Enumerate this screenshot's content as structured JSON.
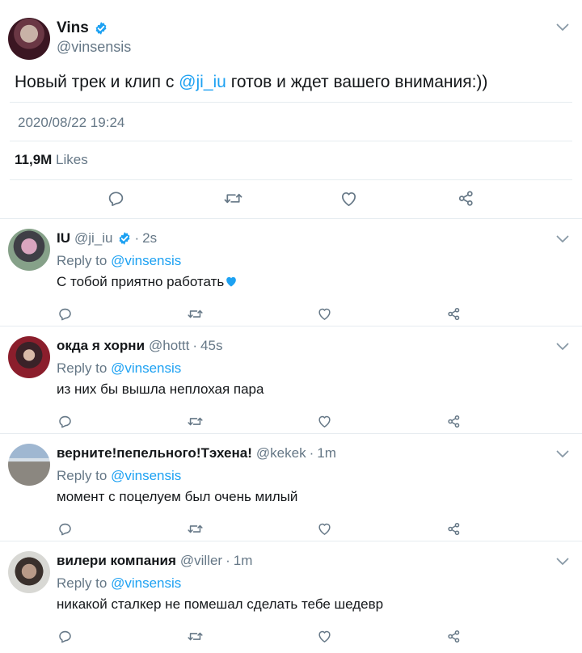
{
  "main_tweet": {
    "name": "Vins",
    "handle": "@vinsensis",
    "text_before": "Новый трек и клип с ",
    "mention": "@ji_iu",
    "text_after": " готов и ждет вашего внимания:))",
    "timestamp": "2020/08/22 19:24",
    "likes_count": "11,9M",
    "likes_label": "Likes"
  },
  "replies": [
    {
      "name": "IU",
      "handle": "@ji_iu",
      "time": "2s",
      "reply_to_label": "Reply to",
      "reply_to_handle": "@vinsensis",
      "text": "С тобой приятно работать",
      "verified": true,
      "emoji": "blue-heart"
    },
    {
      "name": "окда я хорни",
      "handle": "@hottt",
      "time": "45s",
      "reply_to_label": "Reply to",
      "reply_to_handle": "@vinsensis",
      "text": "из них бы вышла неплохая пара",
      "verified": false
    },
    {
      "name": "верните!пепельного!Тэхена!",
      "handle": "@kekek",
      "time": "1m",
      "reply_to_label": "Reply to",
      "reply_to_handle": "@vinsensis",
      "text": "момент с поцелуем был очень милый",
      "verified": false
    },
    {
      "name": "вилери компания",
      "handle": "@viller",
      "time": "1m",
      "reply_to_label": "Reply to",
      "reply_to_handle": "@vinsensis",
      "text": "никакой сталкер не помешал сделать тебе шедевр",
      "verified": false
    }
  ],
  "separator": "·",
  "colors": {
    "accent": "#1da1f2",
    "secondary_text": "#657786",
    "primary_text": "#14171a",
    "divider": "#e6ecf0"
  },
  "icons": [
    "verified-badge-icon",
    "chevron-down-icon",
    "reply-icon",
    "retweet-icon",
    "like-icon",
    "share-icon",
    "blue-heart-icon"
  ]
}
